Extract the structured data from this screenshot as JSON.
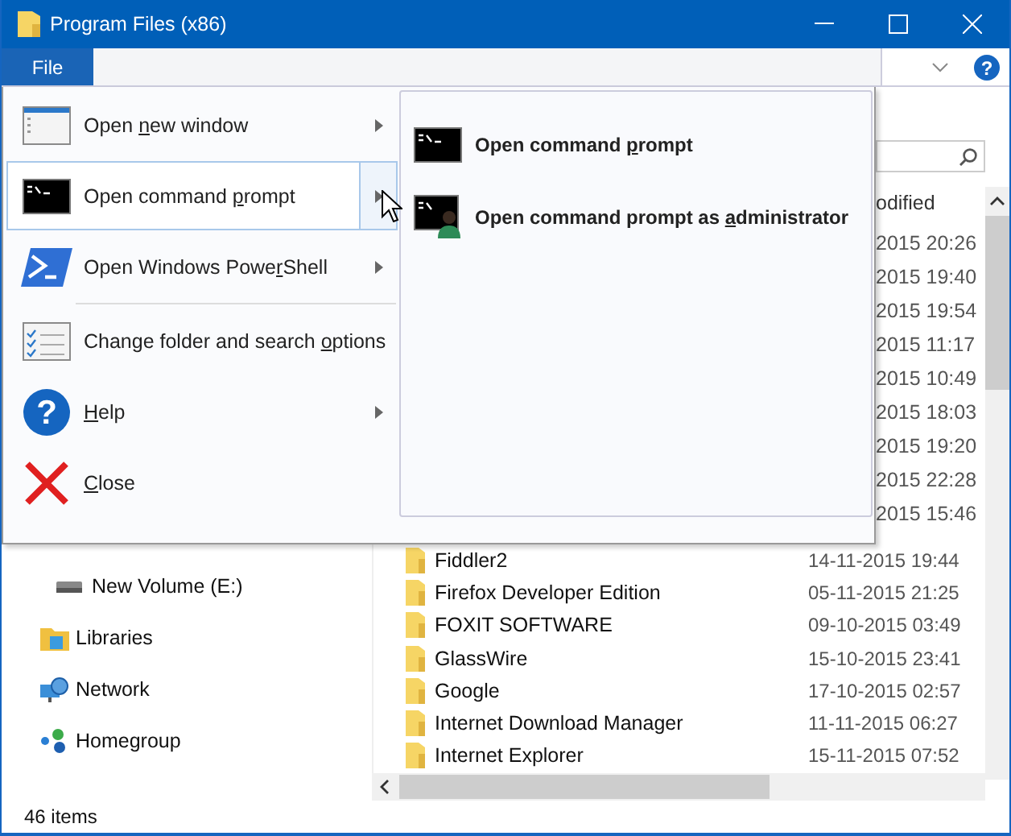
{
  "window": {
    "title": "Program Files (x86)"
  },
  "ribbon": {
    "tabs": [
      {
        "label": "File",
        "selected": true
      }
    ],
    "help_glyph": "?"
  },
  "file_menu": {
    "items": [
      {
        "kind": "window",
        "before": "Open ",
        "key": "n",
        "after": "ew window",
        "submenu": true,
        "selected": false
      },
      {
        "kind": "terminal",
        "before": "Open command ",
        "key": "p",
        "after": "rompt",
        "submenu": true,
        "selected": true
      },
      {
        "kind": "powershell",
        "before": "Open Windows Powe",
        "key": "r",
        "after": "Shell",
        "submenu": true,
        "selected": false
      },
      {
        "kind": "options",
        "before": "Change folder and search ",
        "key": "o",
        "after": "ptions",
        "submenu": false,
        "selected": false
      },
      {
        "kind": "help",
        "glyph": "?",
        "key": "H",
        "after": "elp",
        "submenu": true,
        "selected": false
      },
      {
        "kind": "close",
        "key": "C",
        "after": "lose",
        "submenu": false,
        "selected": false
      }
    ],
    "submenu": [
      {
        "kind": "terminal",
        "before": "Open command ",
        "key": "p",
        "after": "rompt"
      },
      {
        "kind": "terminal-admin",
        "before": "Open command prompt as ",
        "key": "a",
        "after": "dministrator"
      }
    ]
  },
  "behind_menu": {
    "column_header": "odified",
    "dates": [
      "2015 20:26",
      "2015 19:40",
      "2015 19:54",
      "2015 11:17",
      "2015 10:49",
      "2015 18:03",
      "2015 19:20",
      "2015 22:28",
      "2015 15:46"
    ]
  },
  "nav_pane": [
    {
      "kind": "drive",
      "label": "New Volume (E:)"
    },
    {
      "kind": "libraries",
      "label": "Libraries"
    },
    {
      "kind": "network",
      "label": "Network"
    },
    {
      "kind": "homegroup",
      "label": "Homegroup"
    }
  ],
  "files": [
    {
      "name": "Fiddler2",
      "date": "14-11-2015 19:44"
    },
    {
      "name": "Firefox Developer Edition",
      "date": "05-11-2015 21:25"
    },
    {
      "name": "FOXIT SOFTWARE",
      "date": "09-10-2015 03:49"
    },
    {
      "name": "GlassWire",
      "date": "15-10-2015 23:41"
    },
    {
      "name": "Google",
      "date": "17-10-2015 02:57"
    },
    {
      "name": "Internet Download Manager",
      "date": "11-11-2015 06:27"
    },
    {
      "name": "Internet Explorer",
      "date": "15-11-2015 07:52"
    }
  ],
  "status_bar": {
    "items": "46 items"
  }
}
